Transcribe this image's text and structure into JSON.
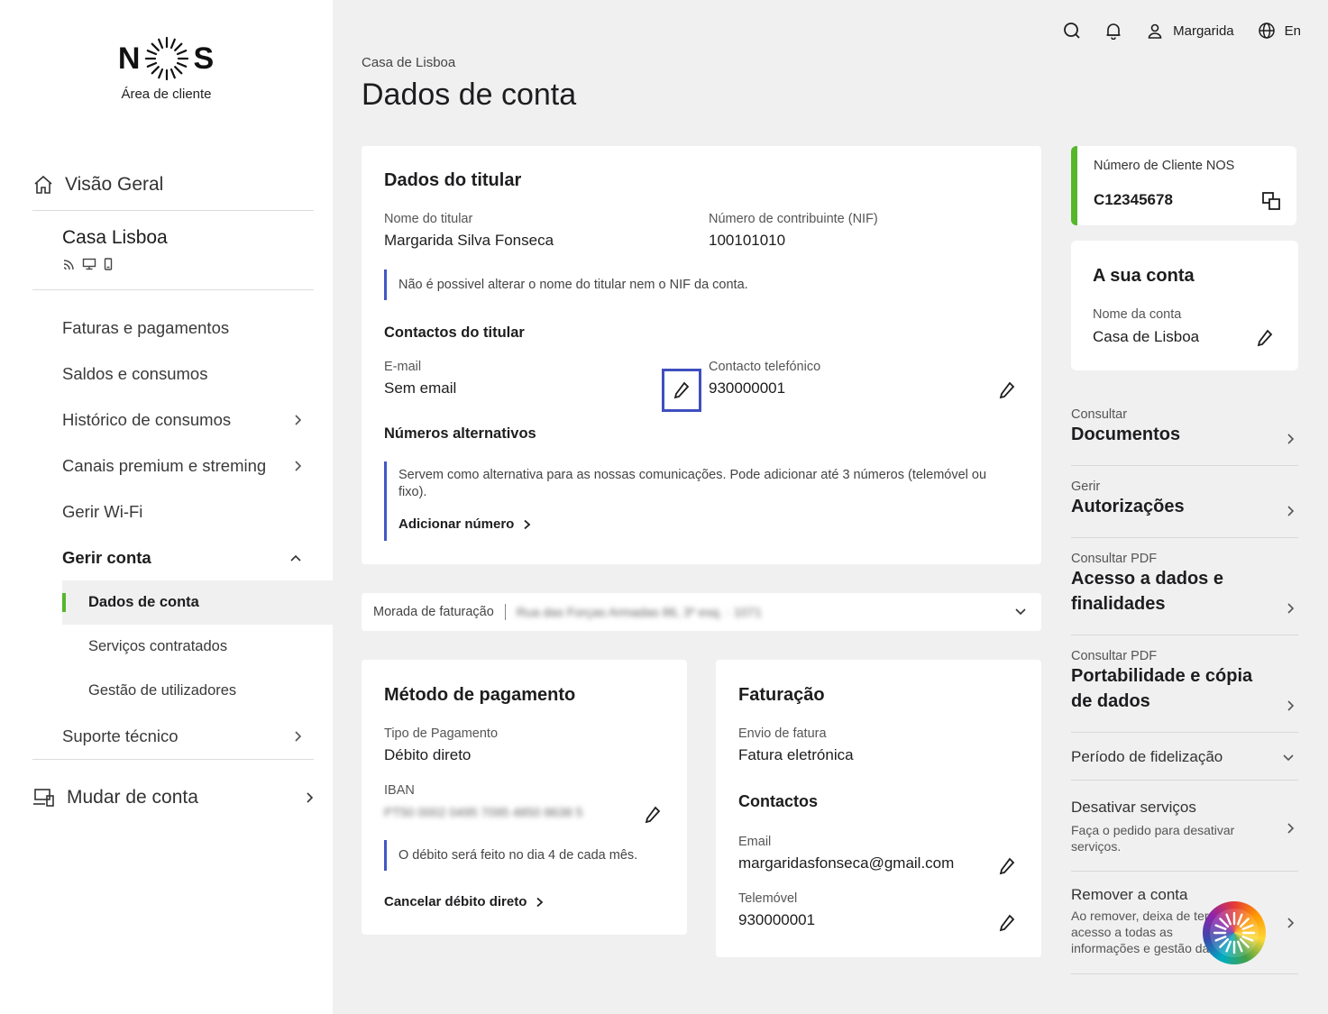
{
  "sidebar": {
    "logo_text_left": "N",
    "logo_text_right": "S",
    "logo_sub": "Área de cliente",
    "overview": "Visão Geral",
    "account_name": "Casa Lisboa",
    "items": [
      {
        "label": "Faturas e pagamentos"
      },
      {
        "label": "Saldos e consumos"
      },
      {
        "label": "Histórico de consumos"
      },
      {
        "label": "Canais premium e streming"
      },
      {
        "label": "Gerir Wi-Fi"
      },
      {
        "label": "Gerir conta"
      }
    ],
    "sub_items": [
      {
        "label": "Dados de conta"
      },
      {
        "label": "Serviços contratados"
      },
      {
        "label": "Gestão de utilizadores"
      }
    ],
    "support": "Suporte técnico",
    "switch_account": "Mudar de conta"
  },
  "topbar": {
    "user": "Margarida",
    "lang": "En"
  },
  "breadcrumb": "Casa de Lisboa",
  "title": "Dados de conta",
  "holder": {
    "heading": "Dados do titular",
    "name_label": "Nome do titular",
    "name_value": "Margarida Silva Fonseca",
    "nif_label": "Número de contribuinte (NIF)",
    "nif_value": "100101010",
    "note": "Não é possivel alterar o nome do titular nem o NIF da conta.",
    "contacts_heading": "Contactos do titular",
    "email_label": "E-mail",
    "email_value": "Sem email",
    "phone_label": "Contacto telefónico",
    "phone_value": "930000001",
    "alt_heading": "Números alternativos",
    "alt_note": "Servem como alternativa para as nossas comunicações. Pode adicionar até 3 números (telemóvel ou fixo).",
    "add_number": "Adicionar número"
  },
  "billing_address": {
    "label": "Morada de faturação",
    "value": "Rua das Forças Armadas 86, 3º esq. · 1071"
  },
  "payment": {
    "heading": "Método de pagamento",
    "type_label": "Tipo de Pagamento",
    "type_value": "Débito direto",
    "iban_label": "IBAN",
    "iban_value": "PT50 0002 0495 7095 4850 8638 5",
    "note": "O débito será feito no dia 4 de cada mês.",
    "cancel": "Cancelar débito direto"
  },
  "invoicing": {
    "heading": "Faturação",
    "send_label": "Envio de fatura",
    "send_value": "Fatura eletrónica",
    "contacts_heading": "Contactos",
    "email_label": "Email",
    "email_value": "margaridasfonseca@gmail.com",
    "mobile_label": "Telemóvel",
    "mobile_value": "930000001"
  },
  "client_number": {
    "label": "Número de Cliente NOS",
    "value": "C12345678"
  },
  "your_account": {
    "heading": "A sua conta",
    "name_label": "Nome da conta",
    "name_value": "Casa de Lisboa"
  },
  "right_list": [
    {
      "kicker": "Consultar",
      "title": "Documentos"
    },
    {
      "kicker": "Gerir",
      "title": "Autorizações"
    },
    {
      "kicker": "Consultar PDF",
      "title": "Acesso a dados e finalidades"
    },
    {
      "kicker": "Consultar PDF",
      "title": "Portabilidade e cópia de dados"
    }
  ],
  "loyalty": "Período de fidelização",
  "deactivate": {
    "title": "Desativar serviços",
    "desc": "Faça o pedido para desativar serviços."
  },
  "remove": {
    "title": "Remover a conta",
    "desc": "Ao remover, deixa de ter acesso a todas as informações e gestão da sua conta."
  },
  "colors": {
    "accent_green": "#57b62c",
    "note_blue": "#4257c4",
    "highlight": "#3f4fbf"
  }
}
